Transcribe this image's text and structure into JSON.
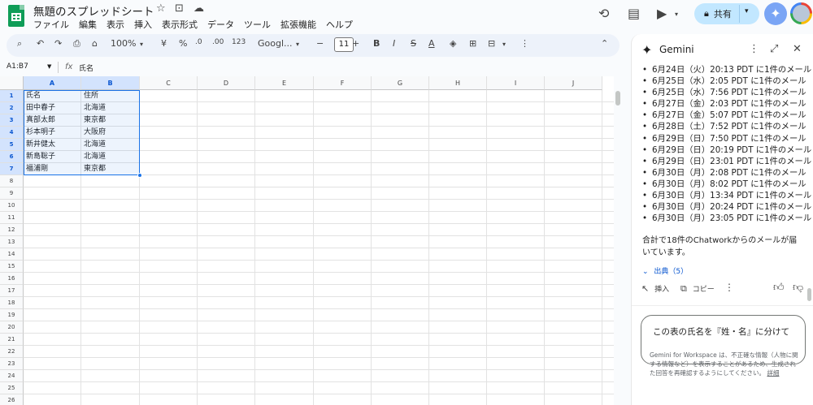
{
  "app": {
    "title": "無題のスプレッドシート",
    "menu": [
      "ファイル",
      "編集",
      "表示",
      "挿入",
      "表示形式",
      "データ",
      "ツール",
      "拡張機能",
      "ヘルプ"
    ],
    "share_label": "共有"
  },
  "toolbar": {
    "zoom": "100%",
    "currency": "¥",
    "percent": "%",
    "decimal_decrease": ".0",
    "decimal_increase": ".00",
    "number_format": "123",
    "font": "Googl...",
    "font_size": "11",
    "bold": "B",
    "italic": "I",
    "strike": "S",
    "text_color": "A"
  },
  "formula_bar": {
    "name_box": "A1:B7",
    "fx": "fx",
    "value": "氏名"
  },
  "sheet": {
    "columns": [
      "A",
      "B",
      "C",
      "D",
      "E",
      "F",
      "G",
      "H",
      "I",
      "J"
    ],
    "rows": [
      "1",
      "2",
      "3",
      "4",
      "5",
      "6",
      "7",
      "8",
      "9",
      "10",
      "11",
      "12",
      "13",
      "14",
      "15",
      "16",
      "17",
      "18",
      "19",
      "20",
      "21",
      "22",
      "23",
      "24",
      "25",
      "26"
    ],
    "data": [
      [
        "氏名",
        "住所"
      ],
      [
        "田中春子",
        "北海道"
      ],
      [
        "真部太郎",
        "東京都"
      ],
      [
        "杉本明子",
        "大阪府"
      ],
      [
        "新井健太",
        "北海道"
      ],
      [
        "新島聡子",
        "北海道"
      ],
      [
        "福浦剛",
        "東京都"
      ]
    ]
  },
  "gemini": {
    "title": "Gemini",
    "emails": [
      "6月24日（火）20:13 PDT に1件のメール",
      "6月25日（水）2:05 PDT に1件のメール",
      "6月25日（水）7:56 PDT に1件のメール",
      "6月27日（金）2:03 PDT に1件のメール",
      "6月27日（金）5:07 PDT に1件のメール",
      "6月28日（土）7:52 PDT に1件のメール",
      "6月29日（日）7:50 PDT に1件のメール",
      "6月29日（日）20:19 PDT に1件のメール",
      "6月29日（日）23:01 PDT に1件のメール",
      "6月30日（月）2:08 PDT に1件のメール",
      "6月30日（月）8:02 PDT に1件のメール",
      "6月30日（月）13:34 PDT に1件のメール",
      "6月30日（月）20:24 PDT に1件のメール",
      "6月30日（月）23:05 PDT に1件のメール"
    ],
    "summary": "合計で18件のChatworkからのメールが届いています。",
    "sources": "出典（5）",
    "insert_label": "挿入",
    "copy_label": "コピー",
    "input_text": "この表の氏名を『姓・名』に分けて",
    "disclaimer": "Gemini for Workspace は、不正確な情報（人物に関する情報など）を表示することがあるため、生成された回答を再確認するようにしてください。",
    "disclaimer_link": "詳細"
  }
}
